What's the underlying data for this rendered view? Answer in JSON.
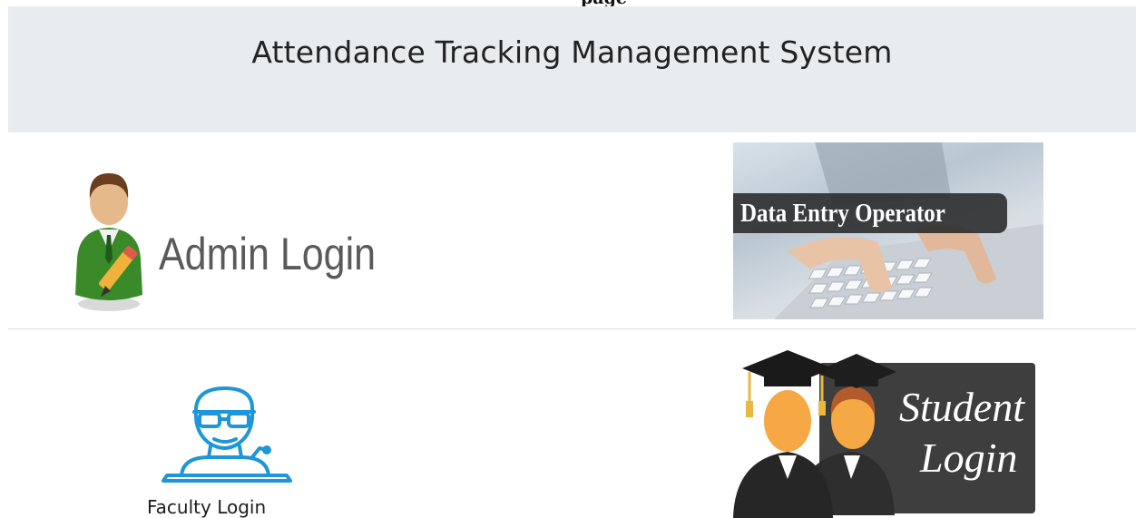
{
  "top_fragment": "page",
  "header": {
    "title": "Attendance Tracking Management System"
  },
  "tiles": {
    "admin": {
      "label": "Admin Login",
      "icon": "admin-user-pencil-icon"
    },
    "data_entry": {
      "label": "Data Entry Operator",
      "icon": "keyboard-hands-photo"
    },
    "faculty": {
      "label": "Faculty Login",
      "icon": "teacher-podium-icon"
    },
    "student": {
      "line1": "Student",
      "line2": "Login",
      "icon": "graduates-icon"
    }
  },
  "colors": {
    "header_bg": "#e9ecef",
    "faculty_icon": "#1e96d8",
    "student_board": "#3e3e3e"
  }
}
